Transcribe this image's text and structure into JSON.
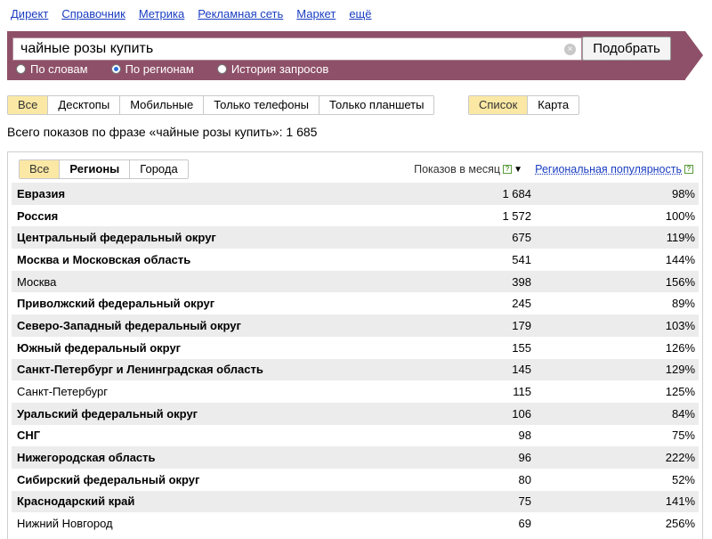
{
  "nav": [
    "Директ",
    "Справочник",
    "Метрика",
    "Рекламная сеть",
    "Маркет",
    "ещё"
  ],
  "search": {
    "value": "чайные розы купить",
    "button": "Подобрать"
  },
  "radios": [
    {
      "label": "По словам",
      "selected": false
    },
    {
      "label": "По регионам",
      "selected": true
    },
    {
      "label": "История запросов",
      "selected": false
    }
  ],
  "device_tabs": [
    {
      "label": "Все",
      "active": true
    },
    {
      "label": "Десктопы",
      "active": false
    },
    {
      "label": "Мобильные",
      "active": false
    },
    {
      "label": "Только телефоны",
      "active": false
    },
    {
      "label": "Только планшеты",
      "active": false
    }
  ],
  "view_tabs": [
    {
      "label": "Список",
      "active": true
    },
    {
      "label": "Карта",
      "active": false
    }
  ],
  "total_text": "Всего показов по фразе «чайные розы купить»: 1 685",
  "region_tabs": [
    {
      "label": "Все",
      "active": true
    },
    {
      "label": "Регионы",
      "active": false,
      "bold": true
    },
    {
      "label": "Города",
      "active": false
    }
  ],
  "columns": {
    "shows": "Показов в месяц",
    "popularity": "Региональная популярность"
  },
  "icons": {
    "help": "?",
    "sort": "▼",
    "clear": "×"
  },
  "rows": [
    {
      "name": "Евразия",
      "count": "1 684",
      "pop": "98%",
      "bold": true
    },
    {
      "name": "Россия",
      "count": "1 572",
      "pop": "100%",
      "bold": true
    },
    {
      "name": "Центральный федеральный округ",
      "count": "675",
      "pop": "119%",
      "bold": true
    },
    {
      "name": "Москва и Московская область",
      "count": "541",
      "pop": "144%",
      "bold": true
    },
    {
      "name": "Москва",
      "count": "398",
      "pop": "156%",
      "bold": false
    },
    {
      "name": "Приволжский федеральный округ",
      "count": "245",
      "pop": "89%",
      "bold": true
    },
    {
      "name": "Северо-Западный федеральный округ",
      "count": "179",
      "pop": "103%",
      "bold": true
    },
    {
      "name": "Южный федеральный округ",
      "count": "155",
      "pop": "126%",
      "bold": true
    },
    {
      "name": "Санкт-Петербург и Ленинградская область",
      "count": "145",
      "pop": "129%",
      "bold": true
    },
    {
      "name": "Санкт-Петербург",
      "count": "115",
      "pop": "125%",
      "bold": false
    },
    {
      "name": "Уральский федеральный округ",
      "count": "106",
      "pop": "84%",
      "bold": true
    },
    {
      "name": "СНГ",
      "count": "98",
      "pop": "75%",
      "bold": true
    },
    {
      "name": "Нижегородская область",
      "count": "96",
      "pop": "222%",
      "bold": true
    },
    {
      "name": "Сибирский федеральный округ",
      "count": "80",
      "pop": "52%",
      "bold": true
    },
    {
      "name": "Краснодарский край",
      "count": "75",
      "pop": "141%",
      "bold": true
    },
    {
      "name": "Нижний Новгород",
      "count": "69",
      "pop": "256%",
      "bold": false
    }
  ],
  "colors": {
    "brand": "#8e5068",
    "active_tab": "#fbe8a4",
    "link": "#1a3dc1"
  }
}
